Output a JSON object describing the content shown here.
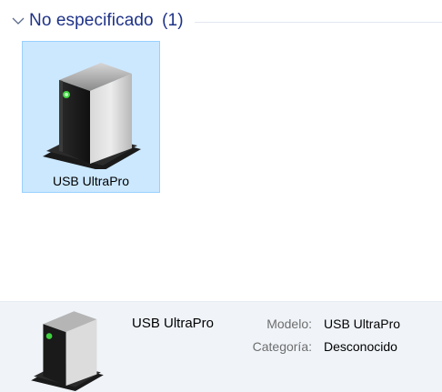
{
  "group": {
    "title": "No especificado",
    "count": "(1)"
  },
  "devices": [
    {
      "name": "USB UltraPro",
      "icon": "generic-device-icon"
    }
  ],
  "details": {
    "name": "USB UltraPro",
    "model_label": "Modelo:",
    "model_value": "USB UltraPro",
    "category_label": "Categoría:",
    "category_value": "Desconocido",
    "icon": "generic-device-icon"
  },
  "colors": {
    "group_title": "#1e3287",
    "selection_bg": "#cce8ff",
    "selection_border": "#99d1ff",
    "details_bg": "#f0f4f9",
    "device_led": "#3fd13f"
  }
}
